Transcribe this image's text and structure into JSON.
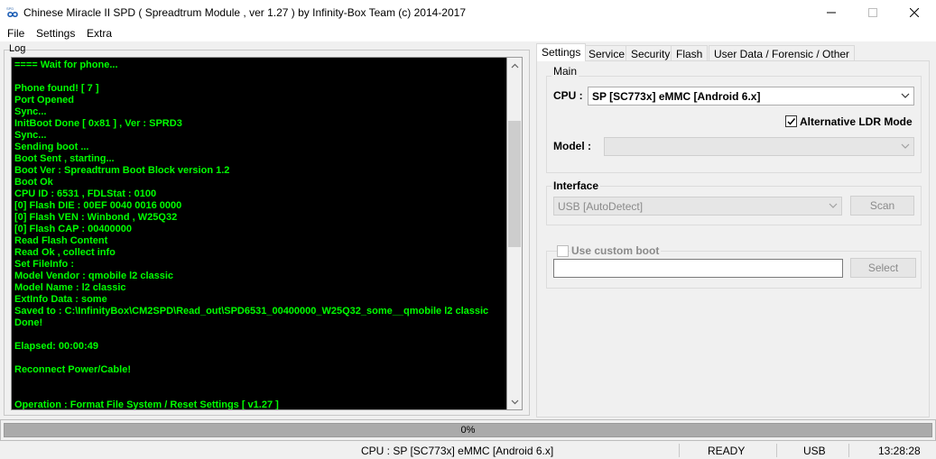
{
  "window": {
    "title": "Chinese Miracle II SPD ( Spreadtrum Module , ver 1.27 ) by Infinity-Box Team (c) 2014-2017",
    "icon": "infinity-logo-icon",
    "controls": {
      "minimize": "minimize-icon",
      "maximize": "maximize-icon",
      "close": "close-icon"
    }
  },
  "menu": {
    "items": [
      {
        "label": "File"
      },
      {
        "label": "Settings"
      },
      {
        "label": "Extra"
      }
    ]
  },
  "log": {
    "label": "Log",
    "text_color": "#00ff00",
    "background": "#000000",
    "lines": [
      " ====  Wait for phone...",
      "",
      "Phone found! [ 7 ]",
      "Port Opened",
      "Sync...",
      "InitBoot Done [ 0x81 ] , Ver : SPRD3",
      "Sync...",
      "Sending boot ...",
      "Boot Sent , starting...",
      "Boot Ver : Spreadtrum Boot Block version 1.2",
      "Boot Ok",
      "CPU ID : 6531 , FDLStat : 0100",
      "[0] Flash DIE : 00EF 0040 0016 0000",
      "[0] Flash VEN : Winbond , W25Q32",
      "[0] Flash CAP : 00400000",
      "Read Flash Content",
      "Read Ok , collect info",
      "Set FileInfo :",
      "Model Vendor : qmobile l2 classic",
      "Model Name   : l2 classic",
      "ExtInfo Data : some",
      "Saved to : C:\\InfinityBox\\CM2SPD\\Read_out\\SPD6531_00400000_W25Q32_some__qmobile l2 classic",
      "Done!",
      "",
      "Elapsed: 00:00:49",
      "",
      "Reconnect Power/Cable!",
      "",
      "",
      "Operation : Format File System / Reset Settings [ v1.27 ]"
    ]
  },
  "tabs": [
    {
      "label": "Settings",
      "active": true
    },
    {
      "label": "Service",
      "active": false
    },
    {
      "label": "Security",
      "active": false
    },
    {
      "label": "Flash",
      "active": false
    },
    {
      "label": "User Data / Forensic / Other",
      "active": false
    }
  ],
  "settings": {
    "main_group": "Main",
    "cpu_label": "CPU :",
    "cpu_value": "SP [SC773x] eMMC [Android 6.x]",
    "alt_ldr_label": "Alternative LDR Mode",
    "alt_ldr_checked": true,
    "model_label": "Model :",
    "model_value": "",
    "interface_group": "Interface",
    "interface_value": "USB [AutoDetect]",
    "scan_label": "Scan",
    "custom_boot_label": "Use custom boot",
    "custom_boot_checked": false,
    "custom_boot_path": "",
    "select_label": "Select"
  },
  "progress": {
    "percent": 0,
    "text": "0%"
  },
  "status": {
    "cpu": "CPU : SP [SC773x] eMMC [Android 6.x]",
    "state": "READY",
    "connection": "USB",
    "time": "13:28:28"
  }
}
